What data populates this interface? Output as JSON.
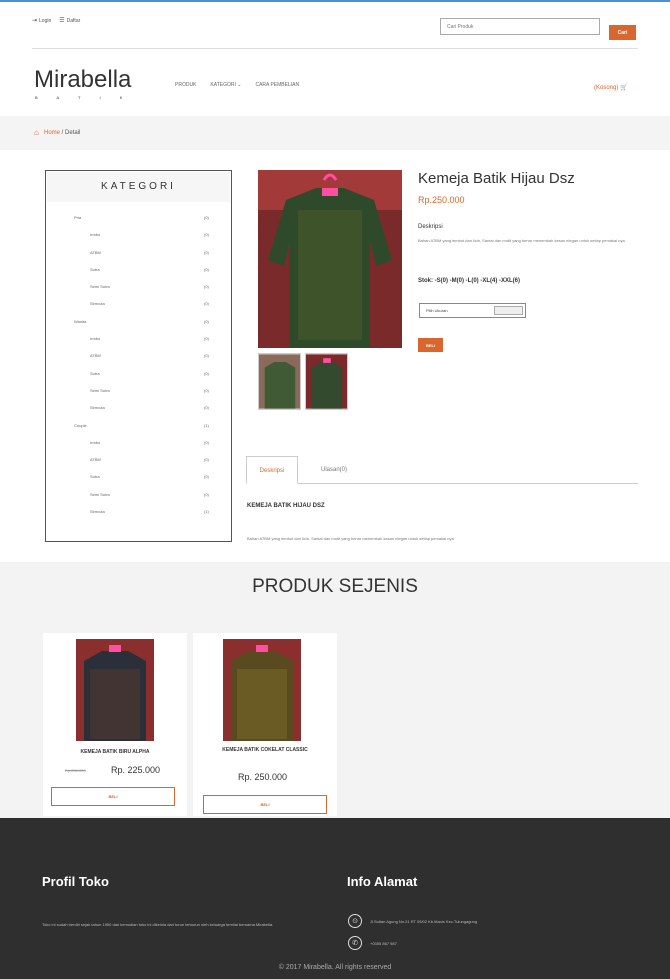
{
  "topbar": {
    "login_label": "Login",
    "daftar_label": "Daftar",
    "search_placeholder": "Cari Produk",
    "search_button": "Cari"
  },
  "header": {
    "logo": "Mirabella",
    "logo_sub": "B A T I K",
    "nav": [
      "PRODUK",
      "KATEGORI",
      "CARA PEMBELIAN"
    ],
    "cart": "(Kosong)"
  },
  "breadcrumb": {
    "home": "Home",
    "separator": " / ",
    "current": "Detail"
  },
  "sidebar": {
    "title": "KATEGORI",
    "items": [
      {
        "name": "Pria",
        "count": "(0)",
        "sub": false
      },
      {
        "name": "Irmbo",
        "count": "(0)",
        "sub": true
      },
      {
        "name": "ATBM",
        "count": "(0)",
        "sub": true
      },
      {
        "name": "Sutra",
        "count": "(0)",
        "sub": true
      },
      {
        "name": "Semi Sutra",
        "count": "(0)",
        "sub": true
      },
      {
        "name": "Sirmoza",
        "count": "(0)",
        "sub": true
      },
      {
        "name": "Wanita",
        "count": "(0)",
        "sub": false
      },
      {
        "name": "Irmbo",
        "count": "(0)",
        "sub": true
      },
      {
        "name": "ATBM",
        "count": "(0)",
        "sub": true
      },
      {
        "name": "Sutra",
        "count": "(0)",
        "sub": true
      },
      {
        "name": "Semi Sutra",
        "count": "(0)",
        "sub": true
      },
      {
        "name": "Sirmoza",
        "count": "(0)",
        "sub": true
      },
      {
        "name": "Couple",
        "count": "(1)",
        "sub": false
      },
      {
        "name": "Irmbo",
        "count": "(0)",
        "sub": true
      },
      {
        "name": "ATBM",
        "count": "(0)",
        "sub": true
      },
      {
        "name": "Sutra",
        "count": "(0)",
        "sub": true
      },
      {
        "name": "Semi Sutra",
        "count": "(0)",
        "sub": true
      },
      {
        "name": "Sirmoza",
        "count": "(1)",
        "sub": true
      }
    ]
  },
  "product": {
    "title": "Kemeja Batik Hijau Dsz",
    "price": "Rp.250.000",
    "desc_label": "Deskripsi",
    "desc": "Bahan ATBM yang lembut dan licin, Santai dan motif yang benar menembah kesan elegan untuk setiap pemakai nya",
    "stock": "Stok: -S(0) -M(0) -L(0) -XL(4) -XXL(6)",
    "size_placeholder": "Pilih Ukuran",
    "buy_button": "BELI"
  },
  "tabs": {
    "tab1": "Deskripsi",
    "tab2": "Ulasan(0)",
    "heading": "KEMEJA BATIK HIJAU DSZ",
    "text": "Bahan ATBM yang lembut dan licin, Santai dan motif yang benar menembah kesan elegan untuk setiap pemakai nya"
  },
  "related": {
    "title": "PRODUK SEJENIS",
    "cards": [
      {
        "name": "KEMEJA BATIK BIRU ALPHA",
        "old_price": "Rp.250.000",
        "price": "Rp. 225.000",
        "button": "BELI"
      },
      {
        "name": "KEMEJA BATIK COKELAT CLASSIC",
        "old_price": "",
        "price": "Rp. 250.000",
        "button": "BELI"
      }
    ]
  },
  "footer": {
    "profil_title": "Profil Toko",
    "profil_text": "Toko ini sudah berdiri sejak tahun 1950 dan kemudian toko ini dikelola dari turun temurun oleh keluarga ternilai bernama Mirabella.",
    "alamat_title": "Info Alamat",
    "address": "Jl.Sultan Agung No.21 RT 05/02 Kb.Manis Kec.Tulungagung",
    "phone": "+0355 867 987",
    "copyright": "© 2017 Mirabella. All rights reserved"
  },
  "colors": {
    "accent": "#d9662c",
    "footer_bg": "#2f2f2f",
    "breadcrumb_bg": "#f4f4f4"
  }
}
